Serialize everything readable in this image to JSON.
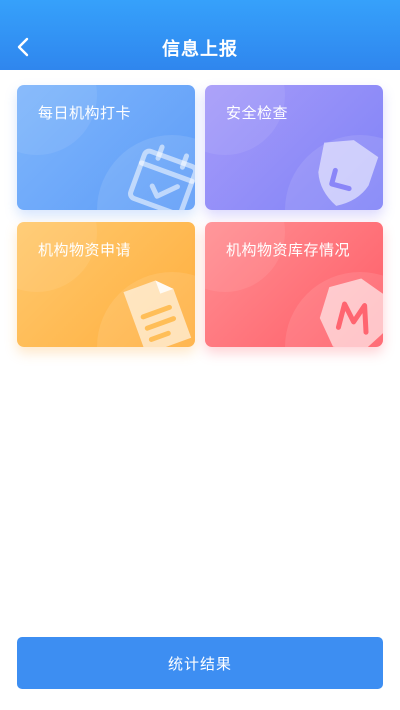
{
  "header": {
    "title": "信息上报",
    "back_icon": "chevron-left-icon"
  },
  "cards": [
    {
      "label": "每日机构打卡",
      "icon": "calendar-check-icon",
      "color": "#6aa6f9"
    },
    {
      "label": "安全检查",
      "icon": "shield-check-icon",
      "color": "#8f8cf8"
    },
    {
      "label": "机构物资申请",
      "icon": "document-icon",
      "color": "#ffb84f"
    },
    {
      "label": "机构物资库存情况",
      "icon": "inventory-badge-icon",
      "color": "#ff6d75"
    }
  ],
  "footer": {
    "button_label": "统计结果",
    "color": "#3d8ef2"
  }
}
